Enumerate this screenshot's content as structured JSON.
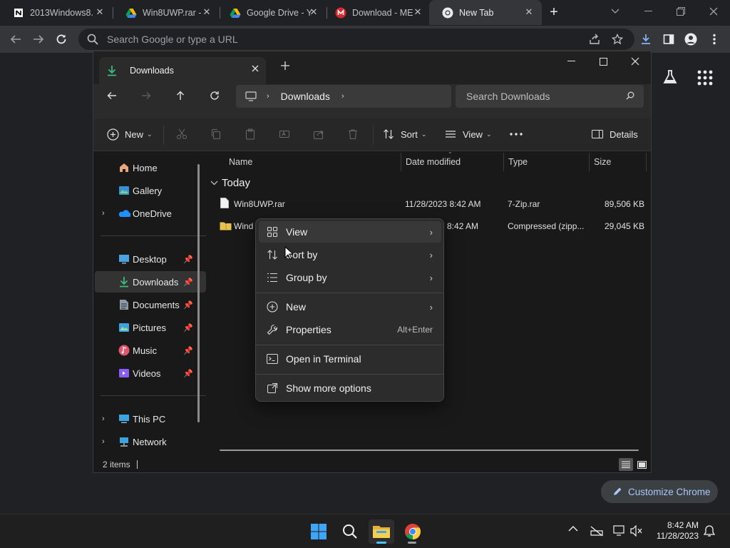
{
  "chrome": {
    "tabs": [
      {
        "title": "2013Windows8.",
        "icon": "notion-icon"
      },
      {
        "title": "Win8UWP.rar -",
        "icon": "google-drive-icon"
      },
      {
        "title": "Google Drive - Y",
        "icon": "google-drive-icon"
      },
      {
        "title": "Download - ME",
        "icon": "mega-icon"
      },
      {
        "title": "New Tab",
        "icon": "chrome-icon"
      }
    ],
    "omnibox_placeholder": "Search Google or type a URL",
    "customize_label": "Customize Chrome"
  },
  "explorer": {
    "tab_title": "Downloads",
    "breadcrumb": [
      "Downloads"
    ],
    "search_placeholder": "Search Downloads",
    "commands": {
      "new": "New",
      "sort": "Sort",
      "view": "View",
      "details": "Details"
    },
    "sidebar": {
      "top": [
        {
          "label": "Home",
          "icon": "home-icon"
        },
        {
          "label": "Gallery",
          "icon": "gallery-icon"
        },
        {
          "label": "OneDrive",
          "icon": "onedrive-icon"
        }
      ],
      "quick": [
        {
          "label": "Desktop",
          "icon": "desktop-icon"
        },
        {
          "label": "Downloads",
          "icon": "downloads-icon"
        },
        {
          "label": "Documents",
          "icon": "documents-icon"
        },
        {
          "label": "Pictures",
          "icon": "pictures-icon"
        },
        {
          "label": "Music",
          "icon": "music-icon"
        },
        {
          "label": "Videos",
          "icon": "videos-icon"
        }
      ],
      "bottom": [
        {
          "label": "This PC",
          "icon": "this-pc-icon"
        },
        {
          "label": "Network",
          "icon": "network-icon"
        }
      ]
    },
    "columns": [
      "Name",
      "Date modified",
      "Type",
      "Size"
    ],
    "group_label": "Today",
    "files": [
      {
        "name": "Win8UWP.rar",
        "date": "11/28/2023 8:42 AM",
        "type": "7-Zip.rar",
        "size": "89,506 KB"
      },
      {
        "name": "Wind",
        "date": "3 8:42 AM",
        "type": "Compressed (zipp...",
        "size": "29,045 KB"
      }
    ],
    "status": "2 items"
  },
  "context_menu": {
    "items": [
      {
        "label": "View",
        "icon": "view-grid-icon",
        "submenu": true
      },
      {
        "label": "Sort by",
        "icon": "sort-icon",
        "submenu": true
      },
      {
        "label": "Group by",
        "icon": "group-by-icon",
        "submenu": true
      },
      {
        "label": "New",
        "icon": "new-plus-icon",
        "submenu": true
      },
      {
        "label": "Properties",
        "icon": "properties-wrench-icon",
        "shortcut": "Alt+Enter"
      },
      {
        "label": "Open in Terminal",
        "icon": "terminal-icon"
      },
      {
        "label": "Show more options",
        "icon": "more-options-icon"
      }
    ]
  },
  "taskbar": {
    "time": "8:42 AM",
    "date": "11/28/2023"
  },
  "colors": {
    "accent": "#4cc2ff",
    "chrome_bg": "#202124",
    "explorer_bg": "#191919"
  }
}
